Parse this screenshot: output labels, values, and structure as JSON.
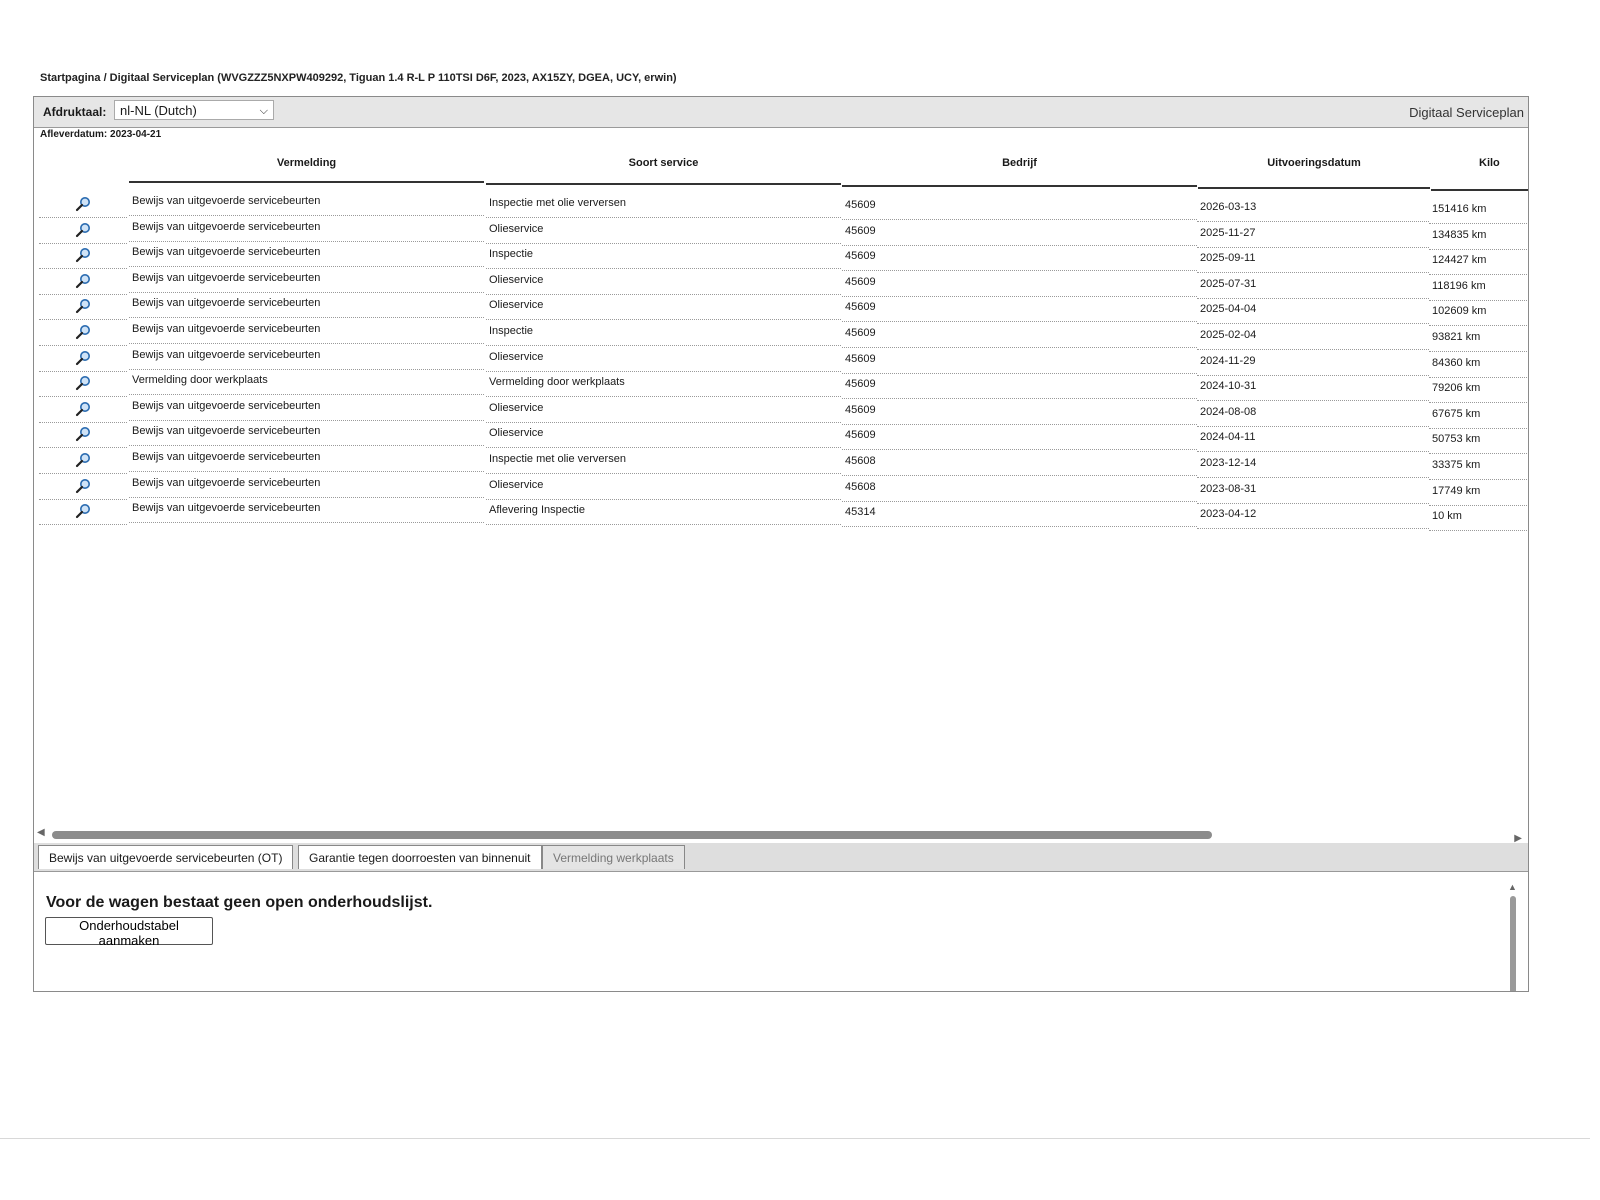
{
  "breadcrumb": "Startpagina / Digitaal Serviceplan (WVGZZZ5NXPW409292, Tiguan 1.4 R-L P 110TSI D6F, 2023, AX15ZY, DGEA, UCY, erwin)",
  "header": {
    "print_language_label": "Afdruktaal:",
    "print_language_value": "nl-NL (Dutch)",
    "app_title": "Digitaal Serviceplan",
    "delivery_date": "Afleverdatum: 2023-04-21"
  },
  "table": {
    "columns": [
      "Vermelding",
      "Soort service",
      "Bedrijf",
      "Uitvoeringsdatum",
      "Kilo"
    ],
    "rows": [
      {
        "vermelding": "Bewijs van uitgevoerde servicebeurten",
        "soort": "Inspectie met olie verversen",
        "bedrijf": "45609",
        "datum": "2026-03-13",
        "km": "151416 km"
      },
      {
        "vermelding": "Bewijs van uitgevoerde servicebeurten",
        "soort": "Olieservice",
        "bedrijf": "45609",
        "datum": "2025-11-27",
        "km": "134835 km"
      },
      {
        "vermelding": "Bewijs van uitgevoerde servicebeurten",
        "soort": "Inspectie",
        "bedrijf": "45609",
        "datum": "2025-09-11",
        "km": "124427 km"
      },
      {
        "vermelding": "Bewijs van uitgevoerde servicebeurten",
        "soort": "Olieservice",
        "bedrijf": "45609",
        "datum": "2025-07-31",
        "km": "118196 km"
      },
      {
        "vermelding": "Bewijs van uitgevoerde servicebeurten",
        "soort": "Olieservice",
        "bedrijf": "45609",
        "datum": "2025-04-04",
        "km": "102609 km"
      },
      {
        "vermelding": "Bewijs van uitgevoerde servicebeurten",
        "soort": "Inspectie",
        "bedrijf": "45609",
        "datum": "2025-02-04",
        "km": "93821 km"
      },
      {
        "vermelding": "Bewijs van uitgevoerde servicebeurten",
        "soort": "Olieservice",
        "bedrijf": "45609",
        "datum": "2024-11-29",
        "km": "84360 km"
      },
      {
        "vermelding": "Vermelding door werkplaats",
        "soort": "Vermelding door werkplaats",
        "bedrijf": "45609",
        "datum": "2024-10-31",
        "km": "79206 km"
      },
      {
        "vermelding": "Bewijs van uitgevoerde servicebeurten",
        "soort": "Olieservice",
        "bedrijf": "45609",
        "datum": "2024-08-08",
        "km": "67675 km"
      },
      {
        "vermelding": "Bewijs van uitgevoerde servicebeurten",
        "soort": "Olieservice",
        "bedrijf": "45609",
        "datum": "2024-04-11",
        "km": "50753 km"
      },
      {
        "vermelding": "Bewijs van uitgevoerde servicebeurten",
        "soort": "Inspectie met olie verversen",
        "bedrijf": "45608",
        "datum": "2023-12-14",
        "km": "33375 km"
      },
      {
        "vermelding": "Bewijs van uitgevoerde servicebeurten",
        "soort": "Olieservice",
        "bedrijf": "45608",
        "datum": "2023-08-31",
        "km": "17749 km"
      },
      {
        "vermelding": "Bewijs van uitgevoerde servicebeurten",
        "soort": "Aflevering Inspectie",
        "bedrijf": "45314",
        "datum": "2023-04-12",
        "km": "10 km"
      }
    ]
  },
  "tabs": [
    {
      "label": "Bewijs van uitgevoerde servicebeurten (OT)",
      "state": "active"
    },
    {
      "label": "Garantie tegen doorroesten van binnenuit",
      "state": "normal"
    },
    {
      "label": "Vermelding werkplaats",
      "state": "disabled"
    }
  ],
  "lower": {
    "notice": "Voor de wagen bestaat geen open onderhoudslijst.",
    "button_label": "Onderhoudstabel aanmaken"
  },
  "icons": {
    "row_icon": "magnifier-icon",
    "icon_color": "#2a6bb0"
  }
}
